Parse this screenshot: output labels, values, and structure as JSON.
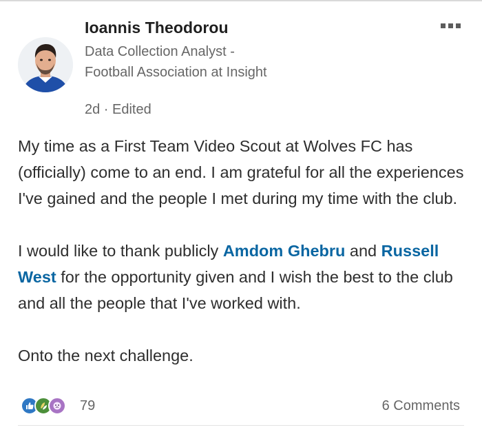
{
  "author": {
    "name": "Ioannis Theodorou",
    "headline": "Data Collection Analyst - Football Association at Insight",
    "meta": "2d · Edited"
  },
  "post": {
    "line1": "My time as a First Team Video Scout at Wolves FC has (officially) come to an end. I am grateful for all the experiences I've gained and the people I met during my time with the club.",
    "p2_before": "I would like to thank publicly ",
    "mention1": "Amdom Ghebru",
    "p2_and": " and ",
    "mention2": "Russell West",
    "p2_after": " for the opportunity given and I wish the best to the club and all the people that I've worked with.",
    "line3": "Onto the next challenge."
  },
  "social": {
    "reaction_icons": [
      "like-icon",
      "celebrate-icon",
      "curious-icon"
    ],
    "reaction_count": "79",
    "comments": "6 Comments"
  },
  "colors": {
    "link": "#0a66a2",
    "like": "#2f78c4",
    "celebrate": "#4c8f3a",
    "curious": "#a874c4"
  }
}
